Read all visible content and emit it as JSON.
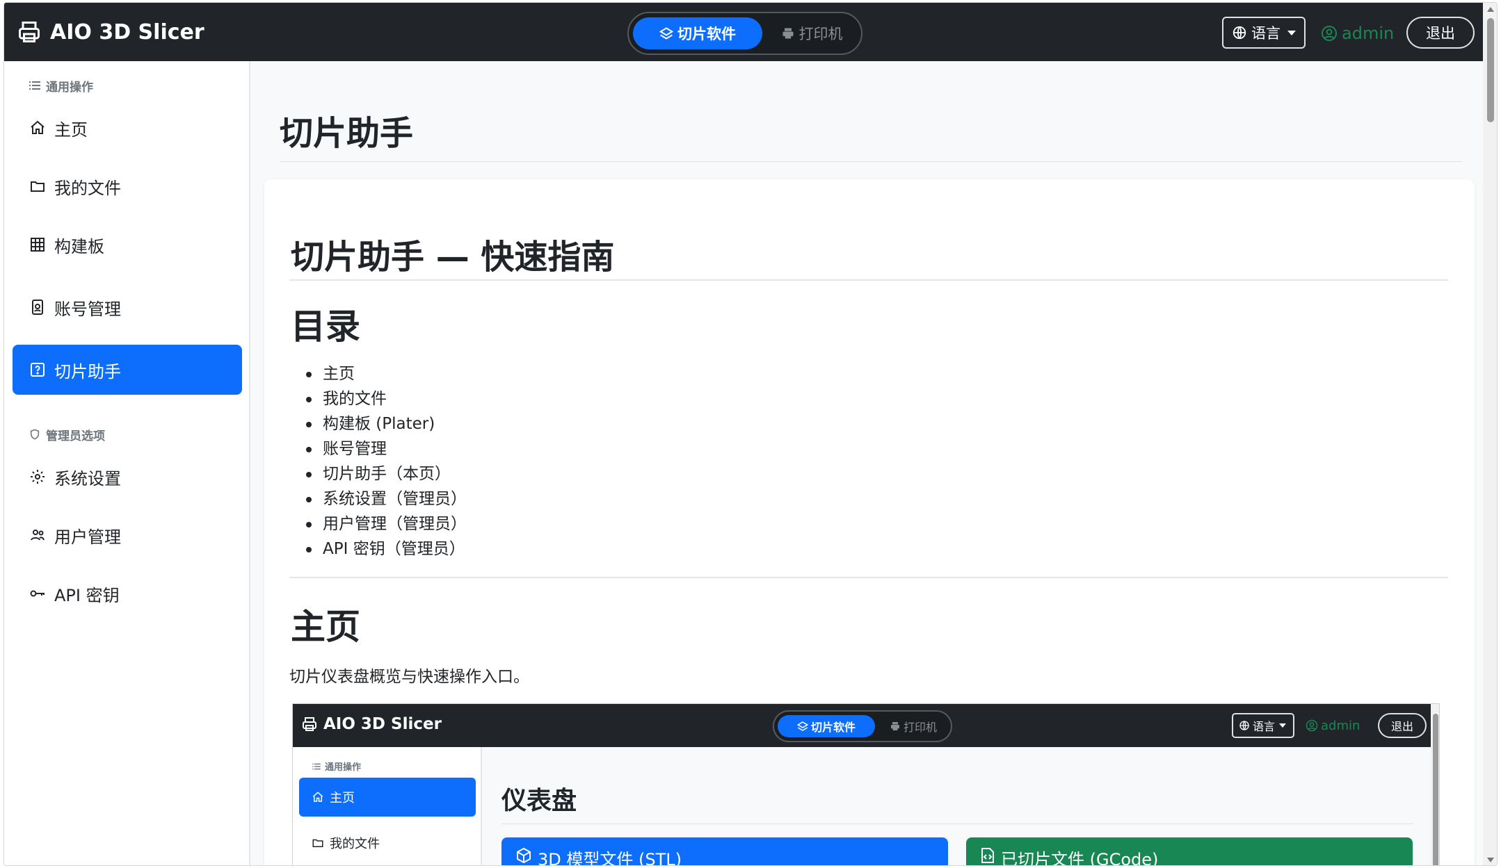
{
  "app": {
    "brand": "AIO 3D Slicer",
    "modes": {
      "active": "切片软件",
      "inactive": "打印机"
    },
    "language_label": "语言",
    "user_name": "admin",
    "logout_label": "退出"
  },
  "sidebar": {
    "section_general": "通用操作",
    "section_admin": "管理员选项",
    "items": [
      {
        "label": "主页",
        "icon": "house-icon",
        "active": false
      },
      {
        "label": "我的文件",
        "icon": "folder-icon",
        "active": false
      },
      {
        "label": "构建板",
        "icon": "grid-icon",
        "active": false
      },
      {
        "label": "账号管理",
        "icon": "person-badge-icon",
        "active": false
      },
      {
        "label": "切片助手",
        "icon": "question-square-icon",
        "active": true
      }
    ],
    "admin_items": [
      {
        "label": "系统设置",
        "icon": "gear-icon"
      },
      {
        "label": "用户管理",
        "icon": "people-icon"
      },
      {
        "label": "API 密钥",
        "icon": "key-icon"
      }
    ]
  },
  "main": {
    "page_title": "切片助手",
    "doc_title": "切片助手 — 快速指南",
    "toc_heading": "目录",
    "toc": [
      "主页",
      "我的文件",
      "构建板 (Plater)",
      "账号管理",
      "切片助手（本页）",
      "系统设置（管理员）",
      "用户管理（管理员）",
      "API 密钥（管理员）"
    ],
    "section_home_heading": "主页",
    "section_home_text": "切片仪表盘概览与快速操作入口。"
  },
  "screenshot": {
    "brand": "AIO 3D Slicer",
    "mode_active": "切片软件",
    "mode_inactive": "打印机",
    "language_label": "语言",
    "user_name": "admin",
    "logout_label": "退出",
    "sidebar_section": "通用操作",
    "sidebar_items": [
      "主页",
      "我的文件"
    ],
    "title": "仪表盘",
    "card_stl": "3D 模型文件 (STL)",
    "card_gcode": "已切片文件 (GCode)"
  },
  "colors": {
    "navbar": "#212529",
    "accent": "#0d6efd",
    "success": "#198754"
  }
}
